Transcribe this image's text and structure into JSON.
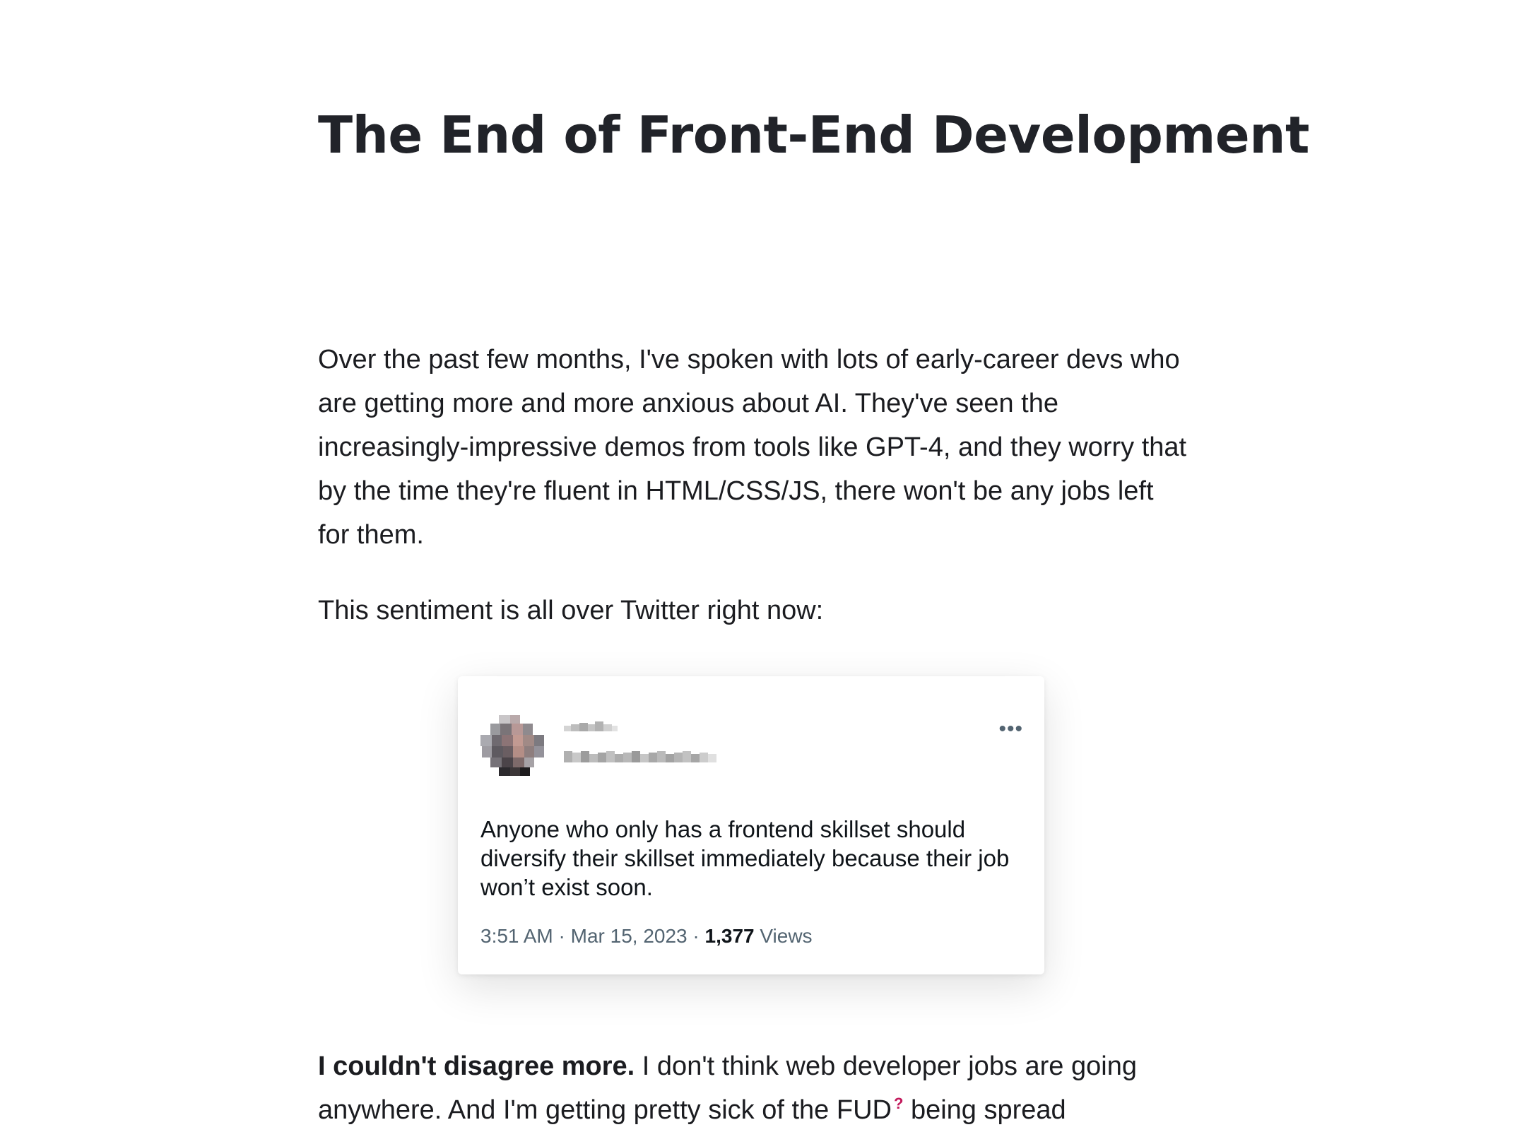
{
  "article": {
    "title": "The End of Front-End Development",
    "paragraph1": "Over the past few months, I've spoken with lots of early-career devs who are getting more and more anxious about AI. They've seen the increasingly-impressive demos from tools like GPT-4, and they worry that by the time they're fluent in HTML/CSS/JS, there won't be any jobs left for them.",
    "paragraph2": "This sentiment is all over Twitter right now:",
    "paragraph3_bold": "I couldn't disagree more.",
    "paragraph3_text": " I don't think web developer jobs are going anywhere. And I'm getting pretty sick of the FUD",
    "paragraph3_footnote": "?",
    "paragraph3_after": " being spread"
  },
  "tweet": {
    "more_label": "•••",
    "text": "Anyone who only has a frontend skillset should diversify their skillset immediately because their job won’t exist soon.",
    "time": "3:51 AM",
    "separator": " · ",
    "date": "Mar 15, 2023",
    "views_count": "1,377",
    "views_label": " Views",
    "avatar_icon": "blurred-avatar-icon"
  }
}
